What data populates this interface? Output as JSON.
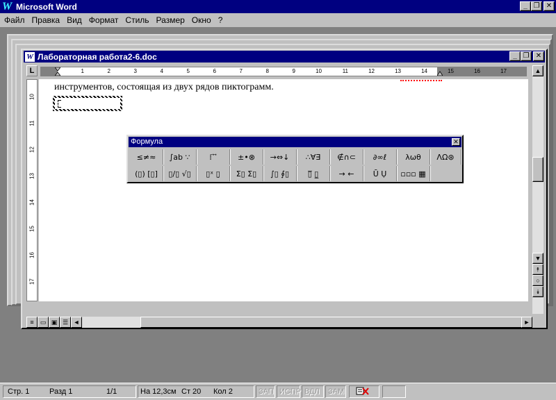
{
  "app": {
    "title": "Microsoft Word",
    "logo": "W"
  },
  "window_controls": {
    "minimize": "_",
    "restore": "❐",
    "close": "✕"
  },
  "menu": [
    "Файл",
    "Правка",
    "Вид",
    "Формат",
    "Стиль",
    "Размер",
    "Окно",
    "?"
  ],
  "document": {
    "title": "Лабораторная работа2-6.doc",
    "icon": "W",
    "text_line": "инструментов, состоящая из двух рядов пиктограмм.",
    "ruler_tab_symbol": "L"
  },
  "ruler": {
    "h_numbers": [
      "1",
      "2",
      "3",
      "4",
      "5",
      "6",
      "7",
      "8",
      "9",
      "10",
      "11",
      "12",
      "13",
      "14",
      "15",
      "16",
      "17"
    ],
    "v_numbers": [
      "10",
      "11",
      "12",
      "13",
      "14",
      "15",
      "16",
      "17"
    ]
  },
  "formula_toolbar": {
    "title": "Формула",
    "close": "✕",
    "row1": [
      "≤≠≈",
      "∫ab ∵",
      "⁞ ⃗ ⃗",
      "±•⊗",
      "→⇔↓",
      "∴∀∃",
      "∉∩⊂",
      "∂∞ℓ",
      "λωθ",
      "ΛΩ⊛"
    ],
    "row2": [
      "(▯) [▯]",
      "▯/▯ √▯",
      "▯ˣ ▯̣",
      "Σ▯ Σ▯",
      "∫▯ ∮▯",
      "▯̅ ▯̲",
      "→ ←",
      "Ū Ụ",
      "▫▫▫ ▦"
    ]
  },
  "scroll_symbols": {
    "up": "▲",
    "down": "▼",
    "left": "◄",
    "right": "►",
    "prev_page": "⯭",
    "select_object": "○",
    "next_page": "⯯"
  },
  "statusbar": {
    "page": "Стр. 1",
    "section": "Разд 1",
    "pages": "1/1",
    "at": "На 12,3см",
    "line": "Ст 20",
    "col": "Кол 2",
    "rec": "ЗАП",
    "trk": "ИСПР",
    "ext": "ВДЛ",
    "ovr": "ЗАМ"
  }
}
